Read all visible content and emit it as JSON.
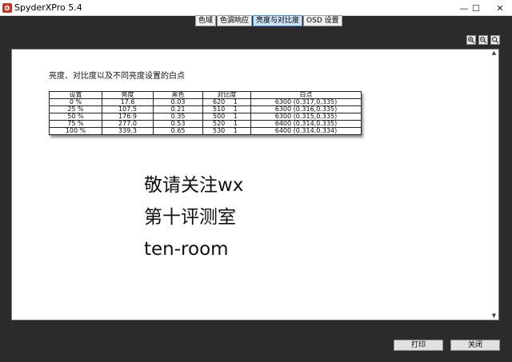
{
  "window": {
    "title": "SpyderXPro 5.4",
    "controls": {
      "minimize": "—",
      "maximize": "☐",
      "close": "✕"
    }
  },
  "tabs": [
    {
      "label": "色域",
      "active": false
    },
    {
      "label": "色调响应",
      "active": false
    },
    {
      "label": "亮度与对比度",
      "active": true
    },
    {
      "label": "OSD 设置",
      "active": false
    }
  ],
  "toolbar": {
    "icons": [
      "zoom-in-icon",
      "zoom-out-icon",
      "zoom-fit-icon"
    ]
  },
  "report": {
    "heading": "亮度、对比度以及不同亮度设置的白点",
    "columns": [
      "设置",
      "亮度",
      "黑色",
      "对比度",
      "白点"
    ],
    "rows": [
      {
        "setting": "0 %",
        "luminance": "17.6",
        "black": "0.03",
        "contrast": "620",
        "ratio": "1",
        "white_point": "6300 (0.317,0.335)"
      },
      {
        "setting": "25 %",
        "luminance": "107.5",
        "black": "0.21",
        "contrast": "510",
        "ratio": "1",
        "white_point": "6300 (0.316,0.335)"
      },
      {
        "setting": "50 %",
        "luminance": "176.9",
        "black": "0.35",
        "contrast": "500",
        "ratio": "1",
        "white_point": "6300 (0.315,0.335)"
      },
      {
        "setting": "75 %",
        "luminance": "277.0",
        "black": "0.53",
        "contrast": "520",
        "ratio": "1",
        "white_point": "6400 (0.314,0.335)"
      },
      {
        "setting": "100 %",
        "luminance": "339.3",
        "black": "0.65",
        "contrast": "530",
        "ratio": "1",
        "white_point": "6400 (0.314,0.334)"
      }
    ]
  },
  "watermark": {
    "line1": "敬请关注wx",
    "line2": "第十评测室",
    "line3": "ten-room"
  },
  "footer": {
    "print_label": "打印",
    "close_label": "关闭"
  },
  "colors": {
    "background": "#2b2b2b",
    "active_tab": "#cde3f7",
    "panel": "#ffffff"
  }
}
